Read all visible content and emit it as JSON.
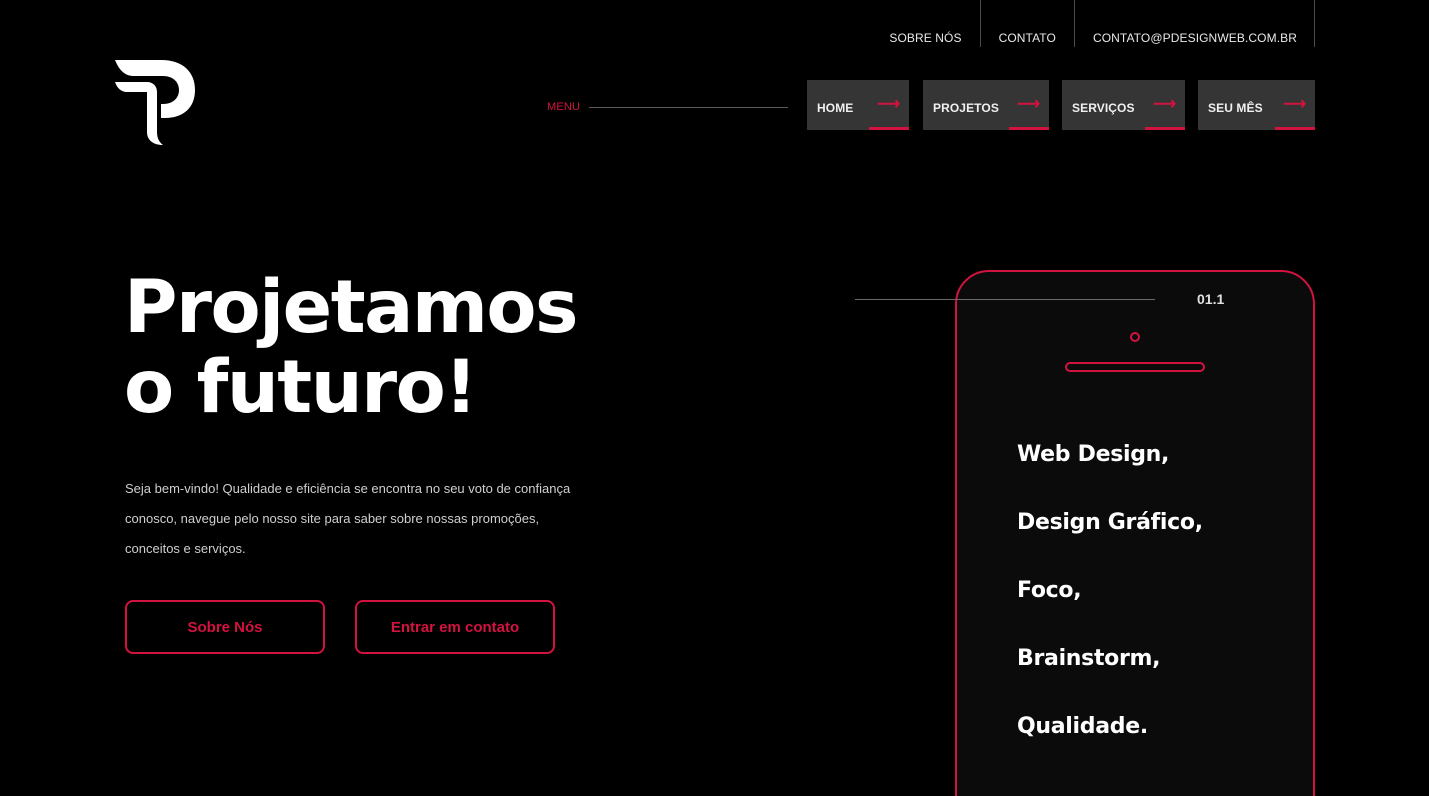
{
  "topbar": {
    "links": [
      "SOBRE NÓS",
      "CONTATO",
      "CONTATO@PDESIGNWEB.COM.BR"
    ]
  },
  "logo": {
    "icon": "p-letter-logo"
  },
  "menu": {
    "label": "MENU",
    "items": [
      {
        "label": "HOME",
        "arrow": "⟶"
      },
      {
        "label": "PROJETOS",
        "arrow": "⟶"
      },
      {
        "label": "SERVIÇOS",
        "arrow": "⟶"
      },
      {
        "label": "SEU MÊS",
        "arrow": "⟶"
      }
    ]
  },
  "hero": {
    "title_line1": "Projetamos",
    "title_line2": "o futuro!",
    "text": "Seja bem-vindo! Qualidade e eficiência se encontra no seu voto de confiança conosco, navegue pelo nosso site para saber sobre nossas promoções, conceitos e serviços.",
    "buttons": [
      "Sobre Nós",
      "Entrar em contato"
    ]
  },
  "phone": {
    "number": "01.1",
    "services": [
      "Web Design,",
      "Design Gráfico,",
      "Foco,",
      "Brainstorm,",
      "Qualidade."
    ]
  },
  "colors": {
    "accent": "#d3133f",
    "background": "#000000",
    "nav_button": "#353535"
  }
}
